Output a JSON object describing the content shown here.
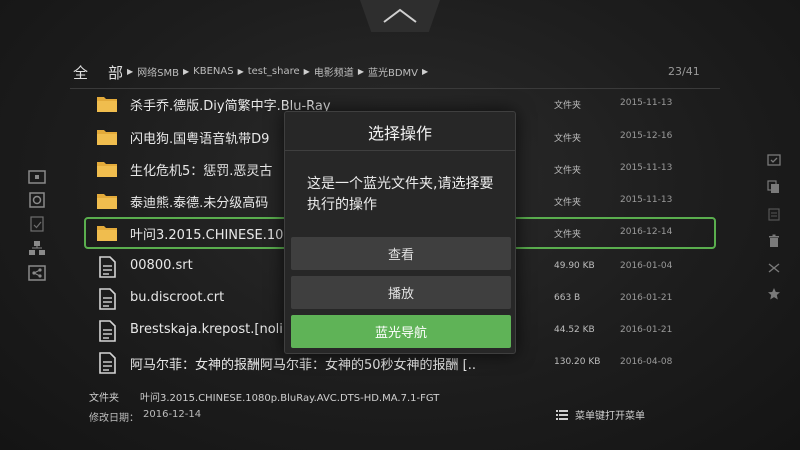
{
  "header": {
    "all_label": "全",
    "path_root": "部",
    "breadcrumb": [
      "网络SMB",
      "KBENAS",
      "test_share",
      "电影频道",
      "蓝光BDMV"
    ],
    "page_count": "23/41"
  },
  "files": [
    {
      "icon": "folder-icon",
      "name": "杀手乔.德版.Diy简繁中字.Blu-Ray",
      "size": "文件夹",
      "date": "2015-11-13"
    },
    {
      "icon": "folder-icon",
      "name": "闪电狗.国粤语音轨带D9",
      "size": "文件夹",
      "date": "2015-12-16"
    },
    {
      "icon": "folder-icon",
      "name": "生化危机5：惩罚.恶灵古",
      "size": "文件夹",
      "date": "2015-11-13"
    },
    {
      "icon": "folder-icon",
      "name": "泰迪熊.泰德.未分级高码",
      "size": "文件夹",
      "date": "2015-11-13"
    },
    {
      "icon": "folder-icon",
      "name": "叶问3.2015.CHINESE.10",
      "size": "文件夹",
      "date": "2016-12-14",
      "selected": true
    },
    {
      "icon": "file-icon",
      "name": "00800.srt",
      "size": "49.90 KB",
      "date": "2016-01-04"
    },
    {
      "icon": "file-icon",
      "name": "bu.discroot.crt",
      "size": "663 B",
      "date": "2016-01-21"
    },
    {
      "icon": "file-icon",
      "name": "Brestskaja.krepost.[nolir",
      "size": "44.52 KB",
      "date": "2016-01-21"
    },
    {
      "icon": "file-icon",
      "name": "阿马尔菲：女神的报酬阿马尔菲：女神的50秒女神的报酬 [..",
      "size": "130.20 KB",
      "date": "2016-04-08"
    }
  ],
  "footer": {
    "type_label": "文件夹",
    "type_value": "叶问3.2015.CHINESE.1080p.BluRay.AVC.DTS-HD.MA.7.1-FGT",
    "date_label": "修改日期：",
    "date_value": "2016-12-14",
    "menu_hint": "菜单键打开菜单"
  },
  "dialog": {
    "title": "选择操作",
    "message": "这是一个蓝光文件夹,请选择要执行的操作",
    "buttons": [
      "查看",
      "播放",
      "蓝光导航"
    ]
  },
  "colors": {
    "accent_green": "#5fb357",
    "selection_border": "#5aae4e",
    "folder_yellow": "#e3aa3a"
  },
  "left_sidebar_icons": [
    "storage-icon",
    "disc-icon",
    "download-icon",
    "network-icon",
    "share-icon"
  ],
  "right_sidebar_icons": [
    "select-icon",
    "copy-icon",
    "paste-icon",
    "delete-icon",
    "cut-icon",
    "favorite-icon"
  ]
}
